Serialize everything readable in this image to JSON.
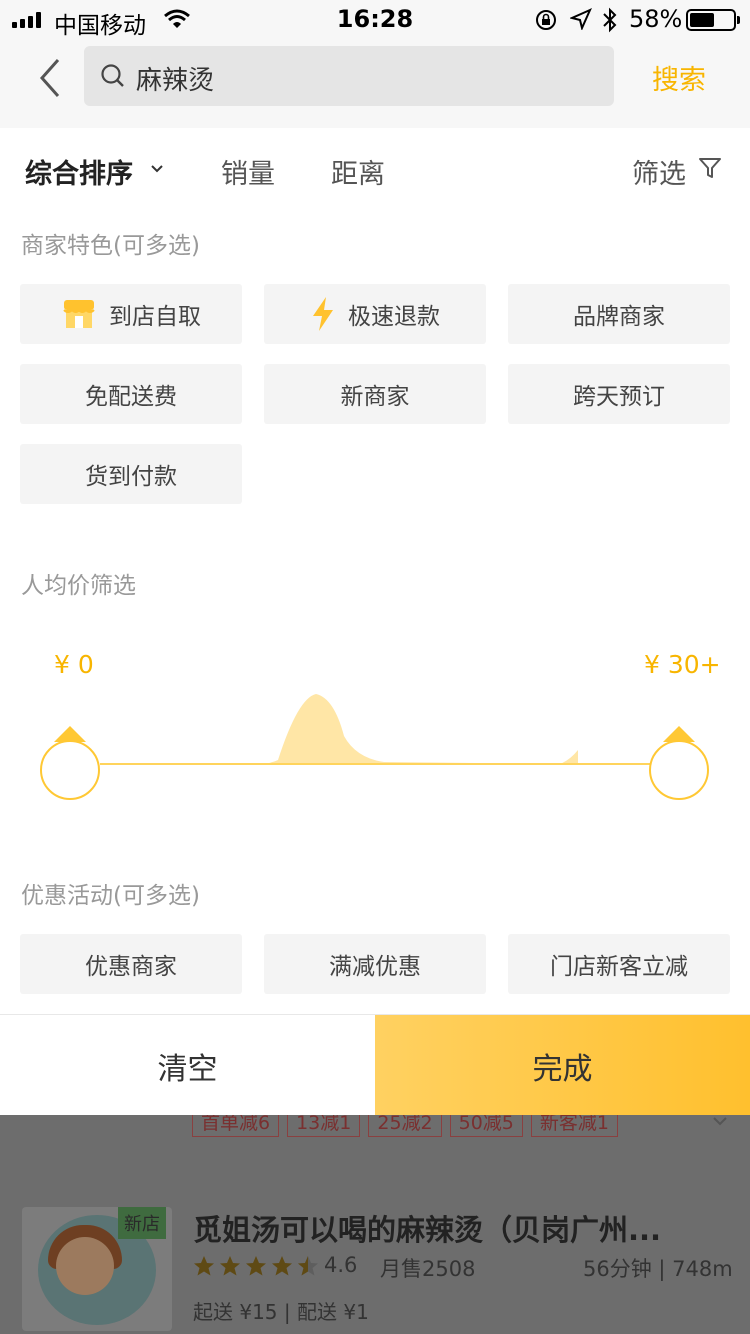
{
  "status_bar": {
    "carrier": "中国移动",
    "time": "16:28",
    "battery": "58%",
    "battery_level": 0.58,
    "icons": [
      "signal-icon",
      "wifi-icon",
      "orientation-lock-icon",
      "location-icon",
      "bluetooth-icon",
      "battery-icon"
    ]
  },
  "nav": {
    "back_icon": "chevron-left-icon",
    "search_icon": "search-icon",
    "query": "麻辣烫",
    "search_button": "搜索"
  },
  "sort_bar": {
    "options": [
      "综合排序",
      "销量",
      "距离"
    ],
    "active_option": "综合排序",
    "filter_label": "筛选",
    "filter_icon": "funnel-icon"
  },
  "merchant_features": {
    "title": "商家特色(可多选)",
    "options": [
      {
        "label": "到店自取",
        "icon": "storefront-icon"
      },
      {
        "label": "极速退款",
        "icon": "lightning-icon"
      },
      {
        "label": "品牌商家"
      },
      {
        "label": "免配送费"
      },
      {
        "label": "新商家"
      },
      {
        "label": "跨天预订"
      },
      {
        "label": "货到付款"
      }
    ]
  },
  "price_filter": {
    "title": "人均价筛选",
    "min_label": "¥ 0",
    "max_label": "¥ 30+",
    "selected_range": [
      0,
      30
    ]
  },
  "promotions": {
    "title": "优惠活动(可多选)",
    "options": [
      {
        "label": "优惠商家"
      },
      {
        "label": "满减优惠"
      },
      {
        "label": "门店新客立减"
      }
    ]
  },
  "actions": {
    "clear": "清空",
    "done": "完成"
  },
  "background_listing": {
    "tags": [
      "首单减6",
      "13减1",
      "25减2",
      "50减5",
      "新客减1"
    ],
    "badge": "新店",
    "shop_name": "觅姐汤可以喝的麻辣烫（贝岗广州...",
    "rating": "4.6",
    "rating_value": 4.6,
    "monthly_sales": "月售2508",
    "eta": "56分钟 | 748m",
    "fees": "起送 ¥15 | 配送 ¥1"
  },
  "colors": {
    "accent": "#f8b500",
    "done_button": "#ffc838",
    "chip_bg": "#f4f4f4",
    "overlay": "#6d6d6d"
  }
}
